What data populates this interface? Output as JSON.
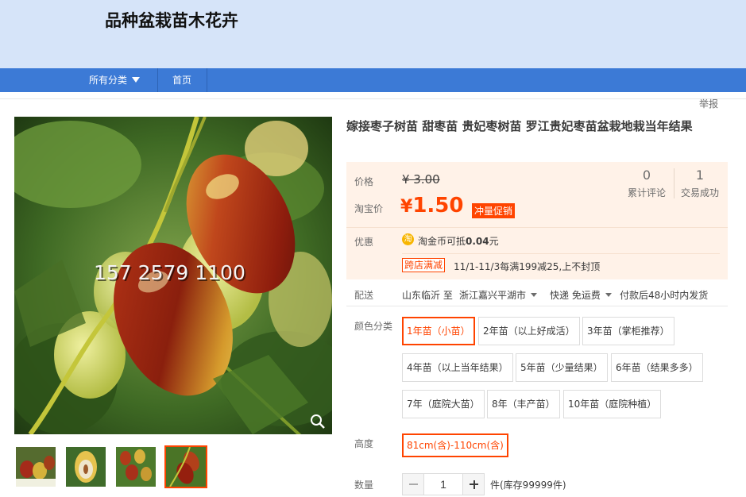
{
  "shop": {
    "name": "品种盆栽苗木花卉"
  },
  "nav": {
    "all_categories": "所有分类",
    "home": "首页"
  },
  "report": "举报",
  "product": {
    "title": "嫁接枣子树苗 甜枣苗 贵妃枣树苗 罗江贵妃枣苗盆栽地栽当年结果",
    "image_watermark": "157 2579 1100"
  },
  "price": {
    "price_label": "价格",
    "original_price": "¥ 3.00",
    "taobao_label": "淘宝价",
    "currency": "¥",
    "taobao_price": "1.50",
    "promo_tag": "冲量促销",
    "reviews_count": "0",
    "reviews_label": "累计评论",
    "sales_count": "1",
    "sales_label": "交易成功"
  },
  "discount": {
    "label": "优惠",
    "coin_icon": "淘",
    "coin_text_prefix": "淘金币可抵",
    "coin_amount": "0.04",
    "coin_text_suffix": "元",
    "cross_tag": "跨店满减",
    "cross_text": "11/1-11/3每满199减25,上不封顶"
  },
  "delivery": {
    "label": "配送",
    "from": "山东临沂 至",
    "to": "浙江嘉兴平湖市",
    "method": "快递 免运费",
    "ship_time": "付款后48小时内发货"
  },
  "color": {
    "label": "颜色分类",
    "options": [
      "1年苗（小苗）",
      "2年苗（以上好成活）",
      "3年苗（掌柜推荐）",
      "4年苗（以上当年结果）",
      "5年苗（少量结果）",
      "6年苗（结果多多）",
      "7年（庭院大苗）",
      "8年（丰产苗）",
      "10年苗（庭院种植）"
    ],
    "selected": "1年苗（小苗）"
  },
  "height": {
    "label": "高度",
    "options": [
      "81cm(含)-110cm(含)"
    ],
    "selected": "81cm(含)-110cm(含)"
  },
  "quantity": {
    "label": "数量",
    "value": "1",
    "stock_text": "件(库存99999件)"
  },
  "colors": {
    "accent": "#ff4400",
    "header_bg": "#d6e4f9",
    "nav_bg": "#3c7ad6",
    "price_bg": "#fff2e8"
  }
}
